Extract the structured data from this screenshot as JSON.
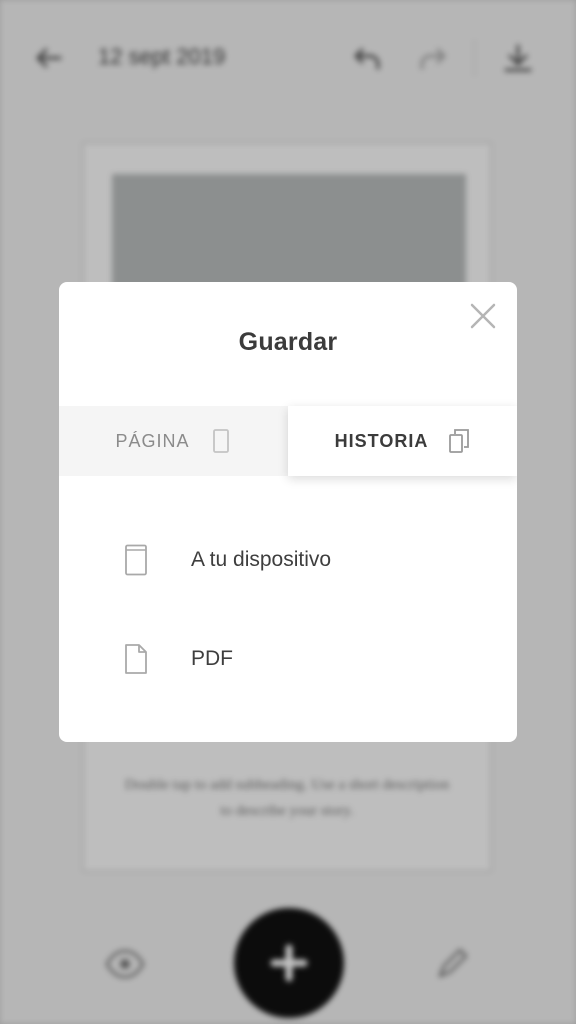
{
  "background": {
    "date": "12 sept 2019",
    "page_caption": "Double tap to add subheading. Use a short description to describe your story."
  },
  "modal": {
    "title": "Guardar",
    "tabs": [
      {
        "label": "PÁGINA",
        "icon": "phone-outline-icon",
        "selected": false
      },
      {
        "label": "HISTORIA",
        "icon": "copy-pages-icon",
        "selected": true
      }
    ],
    "options": [
      {
        "label": "A tu dispositivo",
        "icon": "device-icon"
      },
      {
        "label": "PDF",
        "icon": "document-icon"
      }
    ]
  }
}
